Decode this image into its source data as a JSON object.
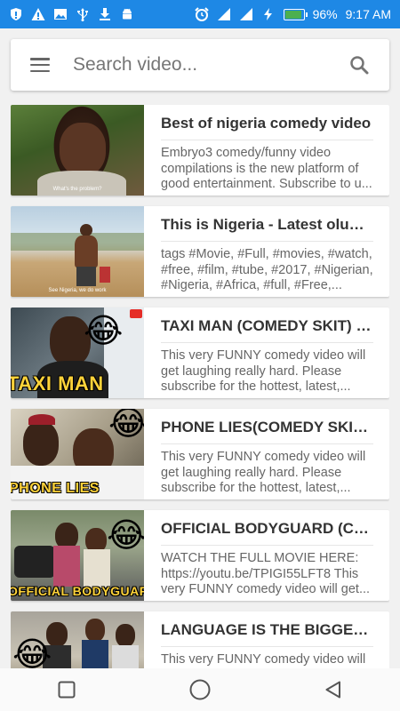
{
  "status": {
    "battery": "96%",
    "time": "9:17 AM"
  },
  "search": {
    "placeholder": "Search video..."
  },
  "videos": [
    {
      "title": "Best of nigeria comedy video",
      "description": "Embryo3 comedy/funny video compilations is the new platform of good entertainment. Subscribe to u...",
      "thumb_caption": "What's the problem?"
    },
    {
      "title": "This is Nigeria - Latest oluwadolarz...",
      "description": "tags #Movie, #Full, #movies, #watch, #free, #film, #tube, #2017, #Nigerian, #Nigeria, #Africa, #full, #Free,...",
      "thumb_caption": "See Nigeria, we do work"
    },
    {
      "title": "TAXI MAN (COMEDY SKIT) (F...",
      "description": "This very FUNNY comedy video will get laughing really hard. Please subscribe for the hottest, latest,...",
      "thumb_caption": "TAXI MAN"
    },
    {
      "title": "PHONE LIES(COMEDY SKIT) (...",
      "description": "This very FUNNY comedy video will get laughing really hard. Please subscribe for the hottest, latest,...",
      "thumb_caption": "PHONE LIES"
    },
    {
      "title": "OFFICIAL BODYGUARD (COM...",
      "description": "WATCH THE FULL MOVIE HERE: https://youtu.be/TPIGI55LFT8 This very FUNNY comedy video will get...",
      "thumb_caption": "OFFICIAL BODYGUARD"
    },
    {
      "title": "LANGUAGE IS THE BIGGEST...",
      "description": "This very FUNNY comedy video will get laughing really hard. Please subscribe for the hottest, latest,...",
      "thumb_caption": ""
    }
  ],
  "colors": {
    "status_bar": "#1e88e5",
    "battery_fill": "#4caf50"
  }
}
